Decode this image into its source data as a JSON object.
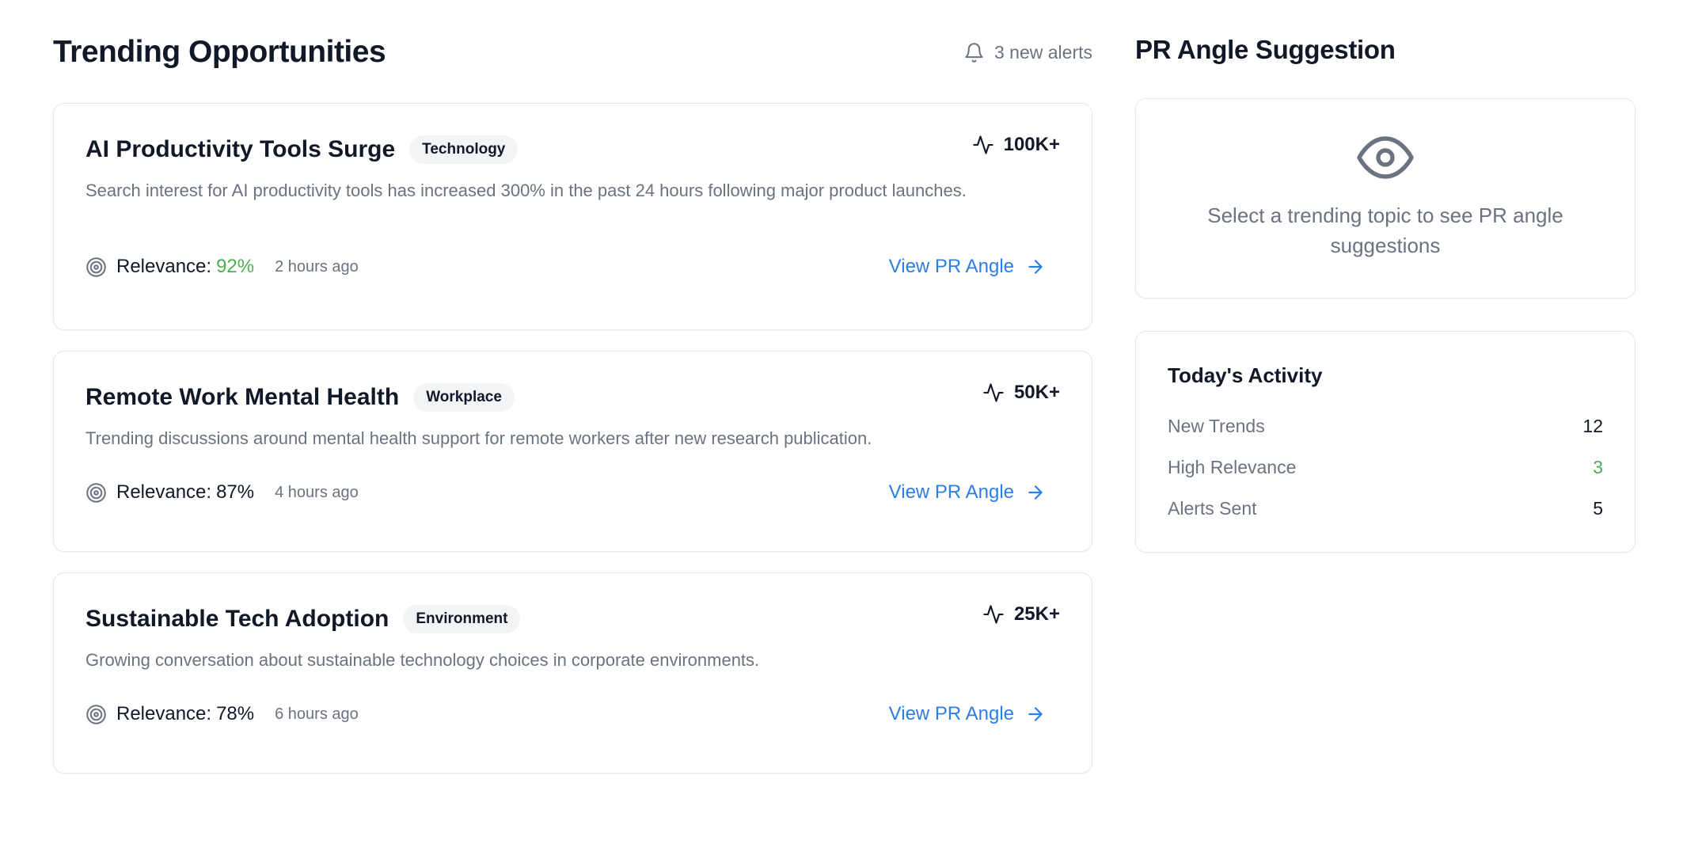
{
  "header": {
    "title": "Trending Opportunities",
    "alerts_label": "3 new alerts"
  },
  "trends": [
    {
      "title": "AI Productivity Tools Surge",
      "tag": "Technology",
      "volume": "100K+",
      "description": "Search interest for AI productivity tools has increased 300% in the past 24 hours following major product launches.",
      "relevance_label": "Relevance:",
      "relevance": "92%",
      "time": "2 hours ago",
      "action": "View PR Angle"
    },
    {
      "title": "Remote Work Mental Health",
      "tag": "Workplace",
      "volume": "50K+",
      "description": "Trending discussions around mental health support for remote workers after new research publication.",
      "relevance_label": "Relevance:",
      "relevance": "87%",
      "time": "4 hours ago",
      "action": "View PR Angle"
    },
    {
      "title": "Sustainable Tech Adoption",
      "tag": "Environment",
      "volume": "25K+",
      "description": "Growing conversation about sustainable technology choices in corporate environments.",
      "relevance_label": "Relevance:",
      "relevance": "78%",
      "time": "6 hours ago",
      "action": "View PR Angle"
    }
  ],
  "pr_panel": {
    "title": "PR Angle Suggestion",
    "empty_text": "Select a trending topic to see PR angle suggestions"
  },
  "activity": {
    "title": "Today's Activity",
    "stats": [
      {
        "label": "New Trends",
        "value": "12"
      },
      {
        "label": "High Relevance",
        "value": "3"
      },
      {
        "label": "Alerts Sent",
        "value": "5"
      }
    ]
  },
  "colors": {
    "accent_link": "#2b7de9",
    "success": "#4caf50",
    "muted_text": "#6b7280",
    "border": "#e5e7eb"
  },
  "icons": {
    "alerts": "bell-icon",
    "volume": "activity-icon",
    "relevance": "target-icon",
    "action": "arrow-right-icon",
    "empty_state": "eye-icon"
  }
}
